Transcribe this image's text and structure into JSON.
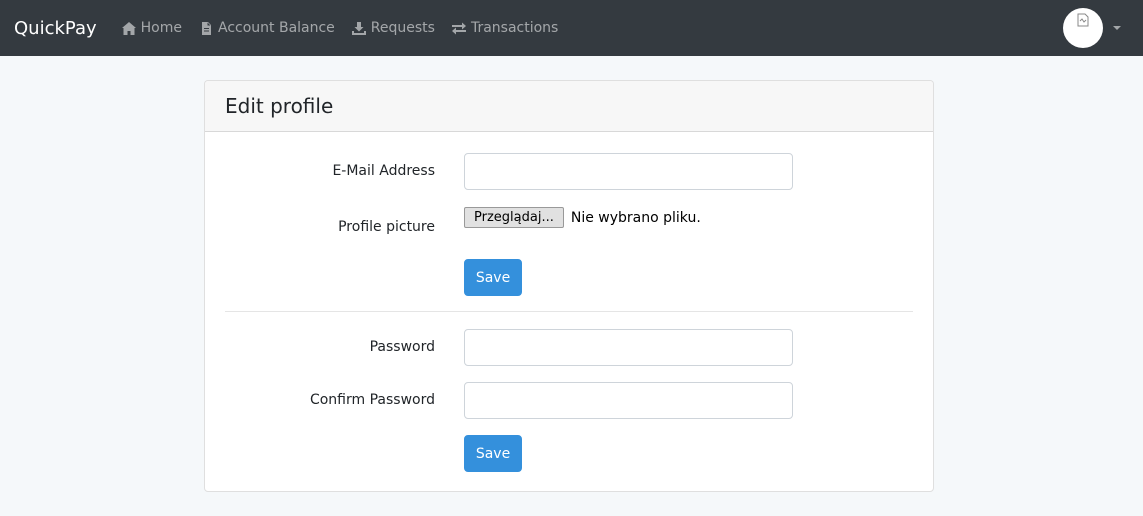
{
  "navbar": {
    "brand": "QuickPay",
    "links": [
      {
        "label": "Home",
        "icon": "home-icon"
      },
      {
        "label": "Account Balance",
        "icon": "file-icon"
      },
      {
        "label": "Requests",
        "icon": "download-icon"
      },
      {
        "label": "Transactions",
        "icon": "exchange-icon"
      }
    ],
    "avatar_icon": "broken-image-icon"
  },
  "card": {
    "title": "Edit profile"
  },
  "profile_form": {
    "email_label": "E-Mail Address",
    "email_value": "",
    "picture_label": "Profile picture",
    "file_button": "Przeglądaj...",
    "file_status": "Nie wybrano pliku.",
    "save_label": "Save"
  },
  "password_form": {
    "password_label": "Password",
    "password_value": "",
    "confirm_label": "Confirm Password",
    "confirm_value": "",
    "save_label": "Save"
  },
  "colors": {
    "navbar_bg": "#343a40",
    "primary": "#3490dc",
    "page_bg": "#f5f8fa"
  }
}
